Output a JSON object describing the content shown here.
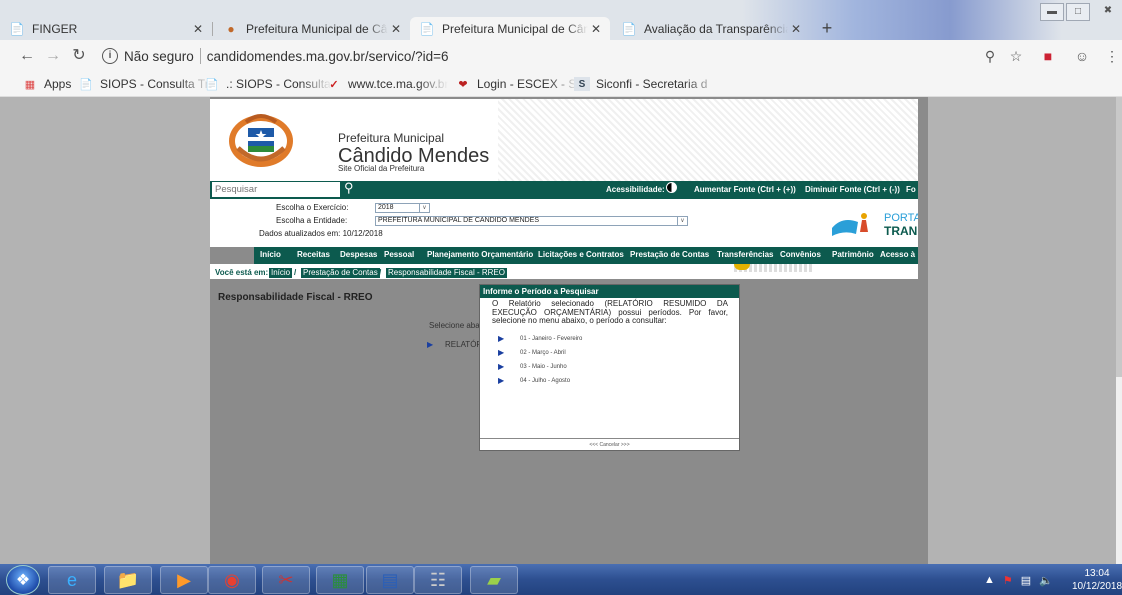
{
  "browser": {
    "tabs": [
      {
        "label": "FINGER",
        "icon": "page-icon"
      },
      {
        "label": "Prefeitura Municipal de Cândido",
        "icon": "coat-of-arms-icon"
      },
      {
        "label": "Prefeitura Municipal de Cândido",
        "icon": "page-icon"
      },
      {
        "label": "Avaliação da Transparência dos",
        "icon": "page-icon"
      }
    ],
    "close_glyph": "✕",
    "new_tab_glyph": "+",
    "security_label": "Não seguro",
    "url": "candidomendes.ma.gov.br/servico/?id=6",
    "bookmarks": [
      {
        "label": "Apps",
        "icon": "apps-grid-icon"
      },
      {
        "label": "SIOPS - Consulta Tra",
        "icon": "page-icon"
      },
      {
        "label": ".: SIOPS - Consulta d",
        "icon": "page-icon"
      },
      {
        "label": "www.tce.ma.gov.br/s",
        "icon": "tce-logo-icon"
      },
      {
        "label": "Login - ESCEX - Soph",
        "icon": "heart-logo-icon"
      },
      {
        "label": "Siconfi - Secretaria d",
        "icon": "siconfi-s-icon"
      }
    ]
  },
  "site": {
    "header_small": "Prefeitura Municipal",
    "header_big": "Cândido Mendes",
    "header_sub": "Site Oficial da Prefeitura",
    "search_placeholder": "Pesquisar",
    "accessibility_label": "Acessibilidade:",
    "increase_font": "Aumentar Fonte (Ctrl + (+))",
    "decrease_font": "Diminuir Fonte (Ctrl + (-))",
    "font_cut": "Fo",
    "exercise_label": "Escolha o Exercício:",
    "exercise_value": "2018",
    "entity_label": "Escolha a Entidade:",
    "entity_value": "PREFEITURA MUNICIPAL DE CANDIDO MENDES",
    "updated_label": "Dados atualizados em: 10/12/2018",
    "portal_text1": "PORTA",
    "portal_text2": "TRAN",
    "nav": [
      "Início",
      "Receitas",
      "Despesas",
      "Pessoal",
      "Planejamento Orçamentário",
      "Licitações e Contratos",
      "Prestação de Contas",
      "Transferências",
      "Convênios",
      "Patrimônio",
      "Acesso à"
    ],
    "breadcrumb_label": "Você está em:",
    "breadcrumb": [
      "Início",
      "Prestação de Contas",
      "Responsabilidade Fiscal - RREO"
    ],
    "section_title": "Responsabilidade Fiscal - RREO",
    "select_text": "Selecione aba",
    "report_text": "RELATÓR"
  },
  "modal": {
    "title": "Informe o Período a Pesquisar",
    "text": "O Relatório selecionado (RELATÓRIO RESUMIDO DA EXECUÇÃO ORÇAMENTÁRIA) possui períodos. Por favor, selecione no menu abaixo, o período a consultar:",
    "periods": [
      "01 - Janeiro - Fevereiro",
      "02 - Março - Abril",
      "03 - Maio - Junho",
      "04 - Julho - Agosto"
    ],
    "cancel": "<<< Cancelar >>>"
  },
  "taskbar": {
    "time": "13:04",
    "date": "10/12/2018",
    "apps": [
      "start-orb",
      "internet-explorer-icon",
      "file-explorer-icon",
      "media-player-icon",
      "chrome-icon",
      "snipping-tool-icon",
      "excel-icon",
      "word-icon",
      "calculator-icon",
      "folder-icon"
    ]
  },
  "colors": {
    "site_green": "#0c5a4e",
    "link_blue": "#1a3fa0"
  }
}
